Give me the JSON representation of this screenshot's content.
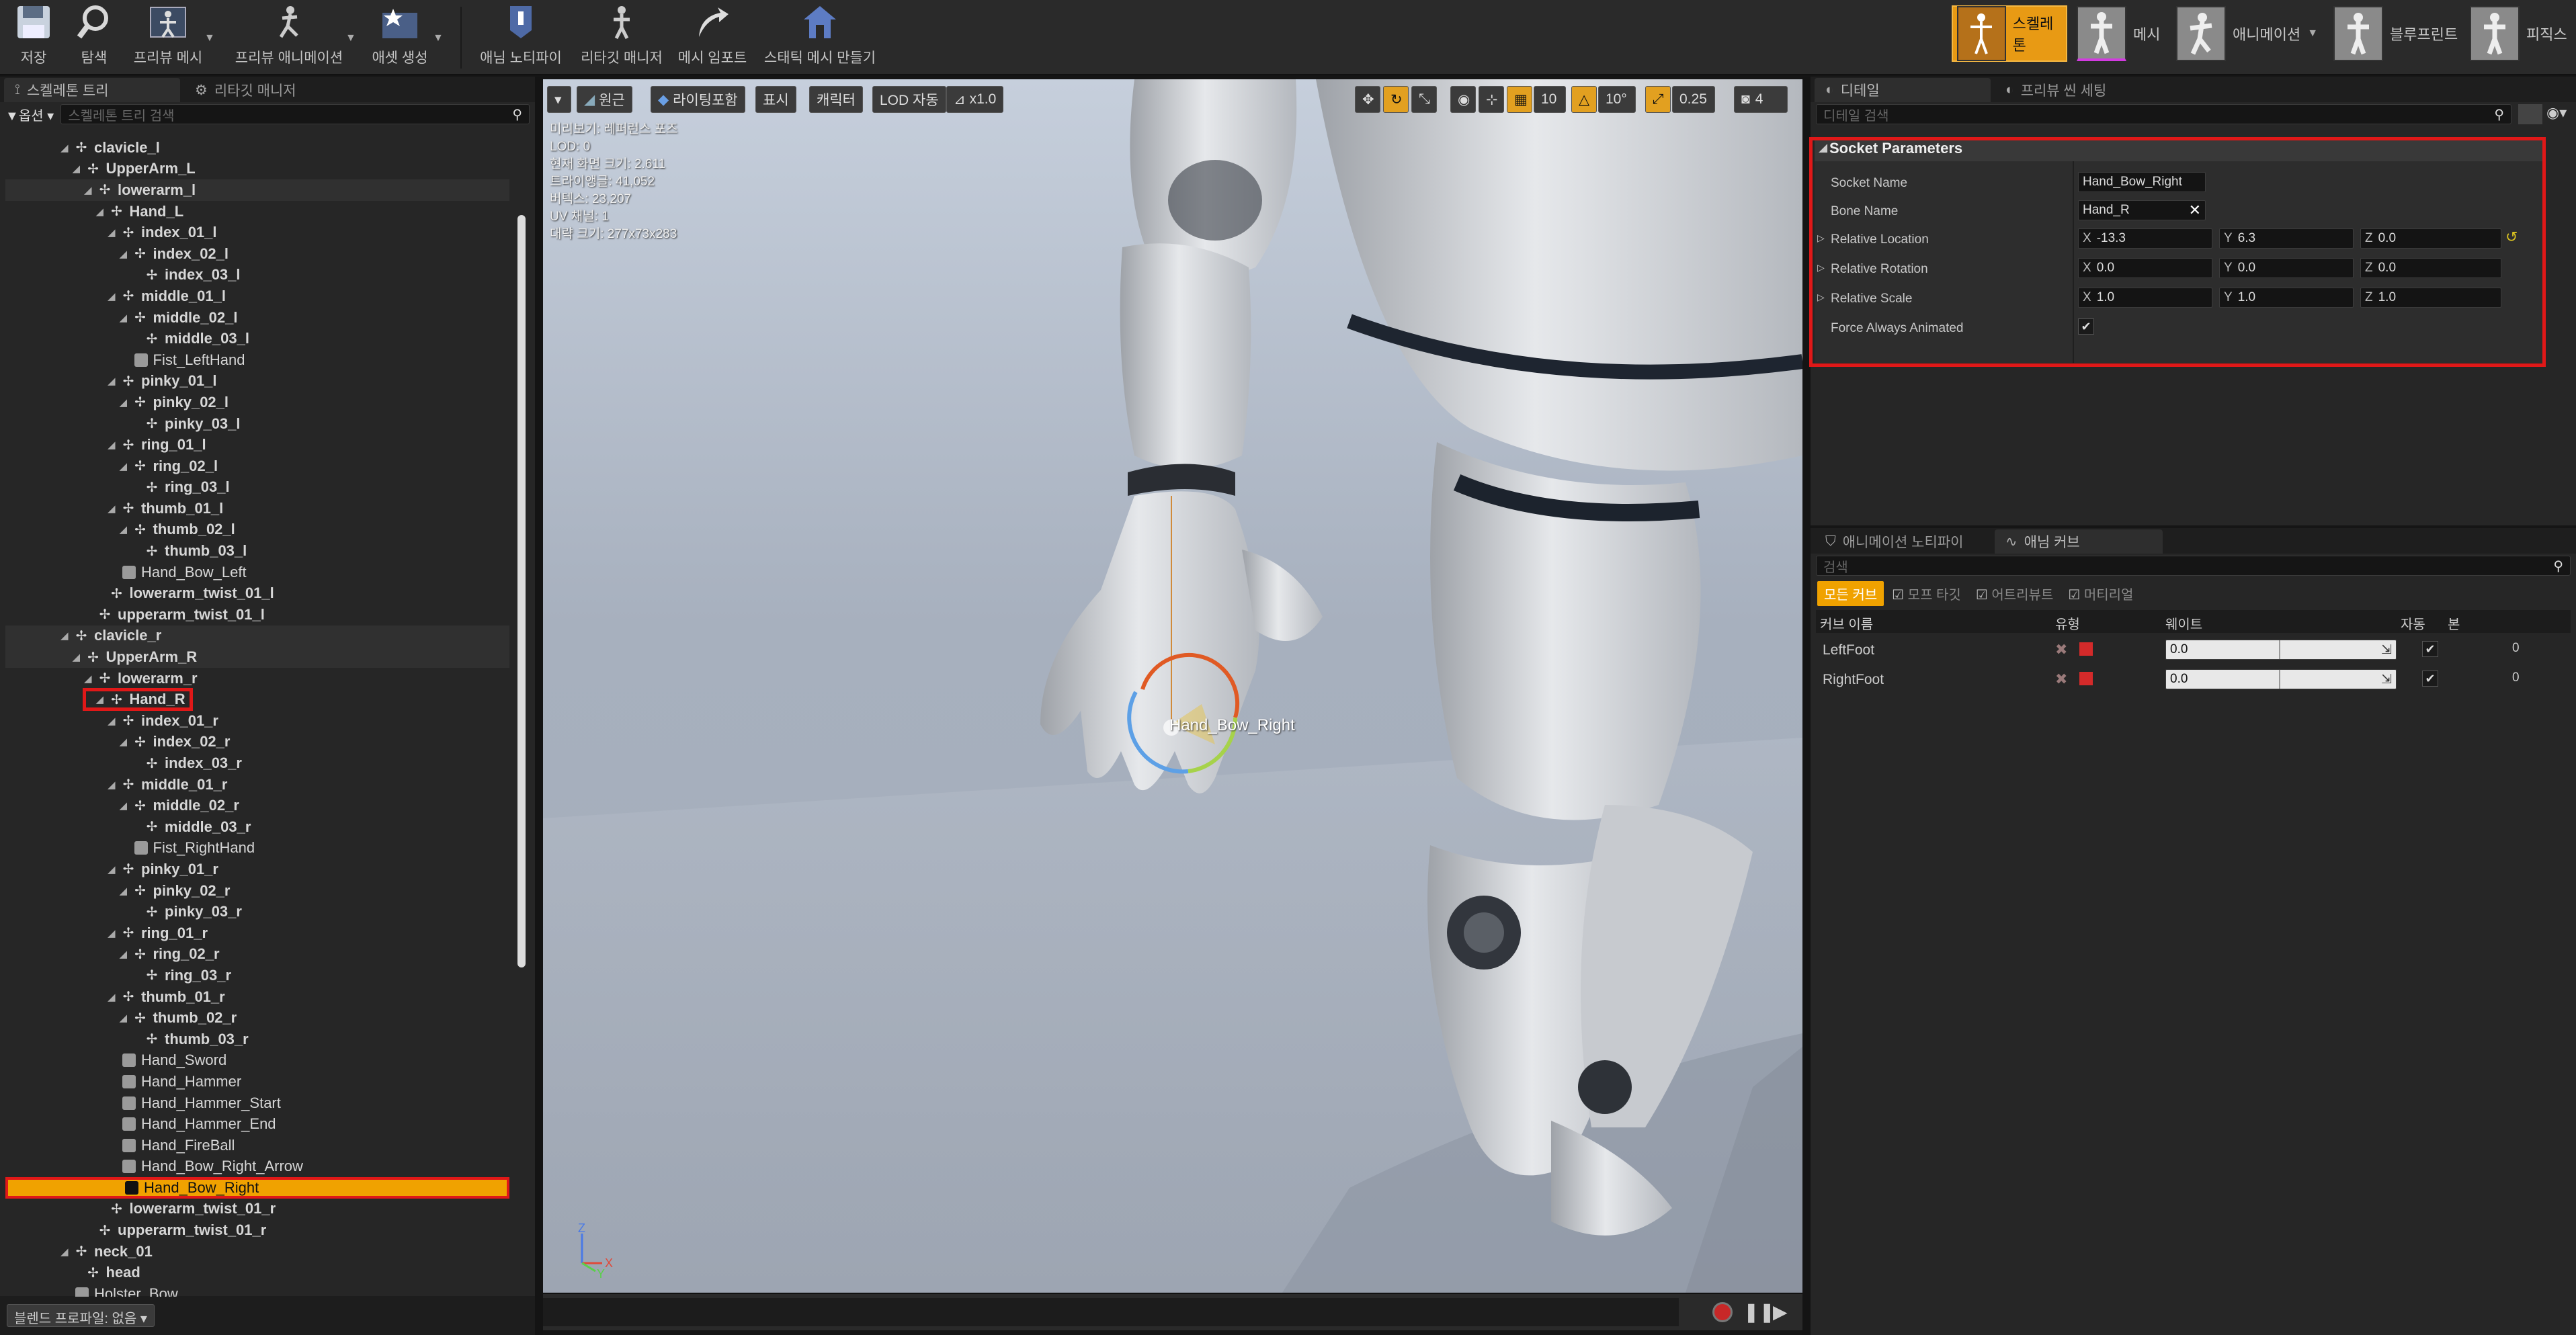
{
  "toolbar": {
    "items": [
      {
        "label": "저장",
        "icon": "save-icon"
      },
      {
        "label": "탐색",
        "icon": "browse-icon"
      },
      {
        "label": "프리뷰 메시",
        "icon": "preview-mesh-icon"
      },
      {
        "label": "프리뷰 애니메이션",
        "icon": "preview-animation-icon"
      },
      {
        "label": "애셋 생성",
        "icon": "create-asset-icon"
      },
      {
        "label": "애님 노티파이",
        "icon": "anim-notify-icon"
      },
      {
        "label": "리타깃 매니저",
        "icon": "retarget-manager-icon"
      },
      {
        "label": "메시 임포트",
        "icon": "mesh-import-icon"
      },
      {
        "label": "스태틱 메시 만들기",
        "icon": "make-static-mesh-icon"
      }
    ],
    "modes": [
      {
        "label": "스켈레톤",
        "active": true
      },
      {
        "label": "메시",
        "active": false
      },
      {
        "label": "애니메이션",
        "active": false
      },
      {
        "label": "블루프린트",
        "active": false
      },
      {
        "label": "피직스",
        "active": false
      }
    ]
  },
  "left_panel": {
    "tabs": [
      "스켈레톤 트리",
      "리타깃 매니저"
    ],
    "options_label": "옵션",
    "search_placeholder": "스켈레톤 트리 검색",
    "footer": "블렌드 프로파일: 없음",
    "tree": [
      {
        "label": "clavicle_l",
        "depth": 6,
        "type": "bone",
        "arrow": true,
        "bold": true
      },
      {
        "label": "UpperArm_L",
        "depth": 7,
        "type": "bone",
        "arrow": true,
        "bold": true
      },
      {
        "label": "lowerarm_l",
        "depth": 8,
        "type": "bone",
        "arrow": true,
        "bold": true,
        "shade": true
      },
      {
        "label": "Hand_L",
        "depth": 9,
        "type": "bone",
        "arrow": true,
        "bold": true
      },
      {
        "label": "index_01_l",
        "depth": 10,
        "type": "bone",
        "arrow": true,
        "bold": true
      },
      {
        "label": "index_02_l",
        "depth": 11,
        "type": "bone",
        "arrow": true,
        "bold": true
      },
      {
        "label": "index_03_l",
        "depth": 12,
        "type": "bone",
        "arrow": false,
        "bold": true
      },
      {
        "label": "middle_01_l",
        "depth": 10,
        "type": "bone",
        "arrow": true,
        "bold": true
      },
      {
        "label": "middle_02_l",
        "depth": 11,
        "type": "bone",
        "arrow": true,
        "bold": true
      },
      {
        "label": "middle_03_l",
        "depth": 12,
        "type": "bone",
        "arrow": false,
        "bold": true
      },
      {
        "label": "Fist_LeftHand",
        "depth": 11,
        "type": "socket",
        "arrow": false,
        "bold": false
      },
      {
        "label": "pinky_01_l",
        "depth": 10,
        "type": "bone",
        "arrow": true,
        "bold": true
      },
      {
        "label": "pinky_02_l",
        "depth": 11,
        "type": "bone",
        "arrow": true,
        "bold": true
      },
      {
        "label": "pinky_03_l",
        "depth": 12,
        "type": "bone",
        "arrow": false,
        "bold": true
      },
      {
        "label": "ring_01_l",
        "depth": 10,
        "type": "bone",
        "arrow": true,
        "bold": true
      },
      {
        "label": "ring_02_l",
        "depth": 11,
        "type": "bone",
        "arrow": true,
        "bold": true
      },
      {
        "label": "ring_03_l",
        "depth": 12,
        "type": "bone",
        "arrow": false,
        "bold": true
      },
      {
        "label": "thumb_01_l",
        "depth": 10,
        "type": "bone",
        "arrow": true,
        "bold": true
      },
      {
        "label": "thumb_02_l",
        "depth": 11,
        "type": "bone",
        "arrow": true,
        "bold": true
      },
      {
        "label": "thumb_03_l",
        "depth": 12,
        "type": "bone",
        "arrow": false,
        "bold": true
      },
      {
        "label": "Hand_Bow_Left",
        "depth": 10,
        "type": "socket",
        "arrow": false,
        "bold": false
      },
      {
        "label": "lowerarm_twist_01_l",
        "depth": 9,
        "type": "bone",
        "arrow": false,
        "bold": true
      },
      {
        "label": "upperarm_twist_01_l",
        "depth": 8,
        "type": "bone",
        "arrow": false,
        "bold": true
      },
      {
        "label": "clavicle_r",
        "depth": 6,
        "type": "bone",
        "arrow": true,
        "bold": true,
        "shade": true
      },
      {
        "label": "UpperArm_R",
        "depth": 7,
        "type": "bone",
        "arrow": true,
        "bold": true,
        "shade": true
      },
      {
        "label": "lowerarm_r",
        "depth": 8,
        "type": "bone",
        "arrow": true,
        "bold": true
      },
      {
        "label": "Hand_R",
        "depth": 9,
        "type": "bone",
        "arrow": true,
        "bold": true,
        "redbox": true
      },
      {
        "label": "index_01_r",
        "depth": 10,
        "type": "bone",
        "arrow": true,
        "bold": true
      },
      {
        "label": "index_02_r",
        "depth": 11,
        "type": "bone",
        "arrow": true,
        "bold": true
      },
      {
        "label": "index_03_r",
        "depth": 12,
        "type": "bone",
        "arrow": false,
        "bold": true
      },
      {
        "label": "middle_01_r",
        "depth": 10,
        "type": "bone",
        "arrow": true,
        "bold": true
      },
      {
        "label": "middle_02_r",
        "depth": 11,
        "type": "bone",
        "arrow": true,
        "bold": true
      },
      {
        "label": "middle_03_r",
        "depth": 12,
        "type": "bone",
        "arrow": false,
        "bold": true
      },
      {
        "label": "Fist_RightHand",
        "depth": 11,
        "type": "socket",
        "arrow": false,
        "bold": false
      },
      {
        "label": "pinky_01_r",
        "depth": 10,
        "type": "bone",
        "arrow": true,
        "bold": true
      },
      {
        "label": "pinky_02_r",
        "depth": 11,
        "type": "bone",
        "arrow": true,
        "bold": true
      },
      {
        "label": "pinky_03_r",
        "depth": 12,
        "type": "bone",
        "arrow": false,
        "bold": true
      },
      {
        "label": "ring_01_r",
        "depth": 10,
        "type": "bone",
        "arrow": true,
        "bold": true
      },
      {
        "label": "ring_02_r",
        "depth": 11,
        "type": "bone",
        "arrow": true,
        "bold": true
      },
      {
        "label": "ring_03_r",
        "depth": 12,
        "type": "bone",
        "arrow": false,
        "bold": true
      },
      {
        "label": "thumb_01_r",
        "depth": 10,
        "type": "bone",
        "arrow": true,
        "bold": true
      },
      {
        "label": "thumb_02_r",
        "depth": 11,
        "type": "bone",
        "arrow": true,
        "bold": true
      },
      {
        "label": "thumb_03_r",
        "depth": 12,
        "type": "bone",
        "arrow": false,
        "bold": true
      },
      {
        "label": "Hand_Sword",
        "depth": 10,
        "type": "socket",
        "arrow": false,
        "bold": false
      },
      {
        "label": "Hand_Hammer",
        "depth": 10,
        "type": "socket",
        "arrow": false,
        "bold": false
      },
      {
        "label": "Hand_Hammer_Start",
        "depth": 10,
        "type": "socket",
        "arrow": false,
        "bold": false
      },
      {
        "label": "Hand_Hammer_End",
        "depth": 10,
        "type": "socket",
        "arrow": false,
        "bold": false
      },
      {
        "label": "Hand_FireBall",
        "depth": 10,
        "type": "socket",
        "arrow": false,
        "bold": false
      },
      {
        "label": "Hand_Bow_Right_Arrow",
        "depth": 10,
        "type": "socket",
        "arrow": false,
        "bold": false
      },
      {
        "label": "Hand_Bow_Right",
        "depth": 10,
        "type": "socket",
        "arrow": false,
        "bold": false,
        "selected": true
      },
      {
        "label": "lowerarm_twist_01_r",
        "depth": 9,
        "type": "bone",
        "arrow": false,
        "bold": true
      },
      {
        "label": "upperarm_twist_01_r",
        "depth": 8,
        "type": "bone",
        "arrow": false,
        "bold": true
      },
      {
        "label": "neck_01",
        "depth": 6,
        "type": "bone",
        "arrow": true,
        "bold": true
      },
      {
        "label": "head",
        "depth": 7,
        "type": "bone",
        "arrow": false,
        "bold": true
      },
      {
        "label": "Holster_Bow",
        "depth": 6,
        "type": "socket",
        "arrow": false,
        "bold": false
      }
    ]
  },
  "viewport": {
    "buttons": {
      "perspective": "원근",
      "lighting": "라이팅포함",
      "show": "표시",
      "character": "캐릭터",
      "lod": "LOD 자동",
      "speed": "x1.0"
    },
    "right_buttons": {
      "grid": "10",
      "rot": "10°",
      "scale": "0.25",
      "cam": "4"
    },
    "info": [
      "미리보기: 레퍼런스 포즈",
      "LOD: 0",
      "현재 화면 크기: 2.611",
      "트라이앵글: 41,052",
      "버텍스: 23,207",
      "UV 채널: 1",
      "대략 크기: 277x73x283"
    ],
    "socket_label": "Hand_Bow_Right",
    "axis": {
      "z": "Z",
      "x": "X",
      "y": "Y"
    }
  },
  "details": {
    "tabs": [
      "디테일",
      "프리뷰 씬 세팅"
    ],
    "search_placeholder": "디테일 검색",
    "section": "Socket Parameters",
    "socket_name_label": "Socket Name",
    "socket_name": "Hand_Bow_Right",
    "bone_name_label": "Bone Name",
    "bone_name": "Hand_R",
    "rel_loc_label": "Relative Location",
    "loc": {
      "x": "-13.3",
      "y": "6.3",
      "z": "0.0"
    },
    "rel_rot_label": "Relative Rotation",
    "rot": {
      "x": "0.0",
      "y": "0.0",
      "z": "0.0"
    },
    "rel_scale_label": "Relative Scale",
    "scale": {
      "x": "1.0",
      "y": "1.0",
      "z": "1.0"
    },
    "force_label": "Force Always Animated",
    "force": true,
    "axes": {
      "x": "X",
      "y": "Y",
      "z": "Z"
    }
  },
  "curves": {
    "tabs": [
      "애니메이션 노티파이",
      "애님 커브"
    ],
    "search_placeholder": "검색",
    "filters": [
      "모든 커브",
      "모프 타깃",
      "어트리뷰트",
      "머티리얼"
    ],
    "headers": [
      "커브 이름",
      "유형",
      "웨이트",
      "자동",
      "본"
    ],
    "rows": [
      {
        "name": "LeftFoot",
        "weight": "0.0",
        "bone": "0"
      },
      {
        "name": "RightFoot",
        "weight": "0.0",
        "bone": "0"
      }
    ]
  },
  "colors": {
    "accent": "#f0a200",
    "highlight": "#e01818",
    "panel": "#262626"
  }
}
